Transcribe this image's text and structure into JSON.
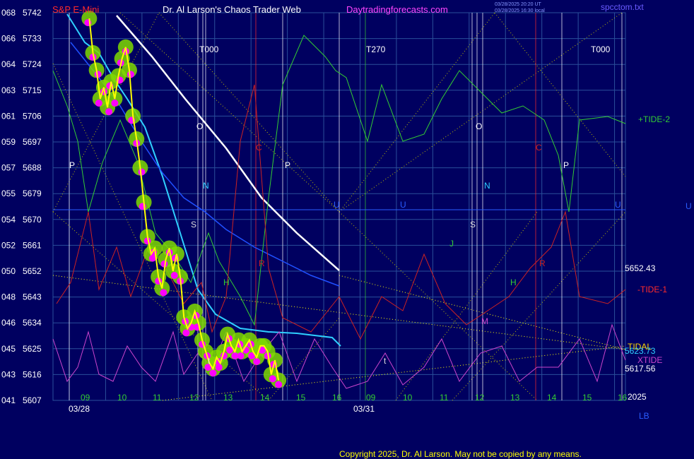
{
  "header": {
    "instrument": "S&P E-Mini",
    "title": "Dr. Al Larson's Chaos Trader Web",
    "site": "Daytradingforecasts.com",
    "stamp1": "03/28/2025 20:20 UT",
    "stamp2": "03/28/2025 16:30 local",
    "file": "spcctom.txt"
  },
  "footer": {
    "copyright": "Copyright 2025, Dr. Al Larson. May not be copied by any means."
  },
  "colors": {
    "background": "#000060",
    "grid": "#2a4f9a",
    "price_bar": "#ffff00",
    "cloud": "#7fd900",
    "dots": "#ff00ff",
    "ma_cyan": "#2fd0ff",
    "ma_blue": "#2050ff",
    "white_curve": "#ffffff",
    "tide2": "#33cc33",
    "tide1": "#cc2222",
    "xtide": "#cc44cc",
    "text_red": "#ff2a2a",
    "text_white": "#ffffff",
    "text_magenta": "#ff44ff"
  },
  "chart_data": {
    "type": "line",
    "title": "S&P E-Mini",
    "y_axis": {
      "labels_left": [
        "068",
        "066",
        "064",
        "063",
        "061",
        "059",
        "057",
        "055",
        "054",
        "052",
        "050",
        "048",
        "046",
        "045",
        "043",
        "041"
      ],
      "labels_price": [
        "5742",
        "5733",
        "5724",
        "5715",
        "5706",
        "5697",
        "5688",
        "5679",
        "5670",
        "5661",
        "5652",
        "5643",
        "5634",
        "5625",
        "5616",
        "5607"
      ],
      "range": [
        5607,
        5742
      ]
    },
    "x_axis": {
      "hour_labels_day1": [
        "09",
        "10",
        "11",
        "12",
        "13",
        "14",
        "15",
        "16"
      ],
      "hour_labels_day2": [
        "09",
        "10",
        "11",
        "12",
        "13",
        "14",
        "15",
        "16"
      ],
      "dates": [
        "03/28",
        "03/31"
      ],
      "year": "2025",
      "lb": "LB"
    },
    "right_labels": {
      "tide2": "+TIDE-2",
      "price_a": "5652.43",
      "tide1": "-TIDE-1",
      "tidal": "TIDAL",
      "price_b": "5623.73",
      "xtide": "XTIDE",
      "price_c": "5617.56",
      "u_right": "U"
    },
    "markers": {
      "t_labels": [
        "T000",
        "T270",
        "T000"
      ],
      "p_labels": [
        "P",
        "P",
        "P"
      ],
      "o_labels": [
        "O",
        "O"
      ],
      "n_labels": [
        "N",
        "N"
      ],
      "s_labels": [
        "S",
        "S"
      ],
      "c_labels": [
        "C",
        "C"
      ],
      "u_labels": [
        "U",
        "U",
        "U"
      ],
      "h_labels": [
        "H",
        "H"
      ],
      "r_labels": [
        "R",
        "R"
      ],
      "j_label": "J",
      "m_label": "M",
      "t_small": [
        "t",
        "t"
      ]
    },
    "price_series": [
      [
        9.55,
        5740
      ],
      [
        9.65,
        5728
      ],
      [
        9.75,
        5722
      ],
      [
        9.85,
        5712
      ],
      [
        9.95,
        5716
      ],
      [
        10.05,
        5709
      ],
      [
        10.15,
        5718
      ],
      [
        10.25,
        5712
      ],
      [
        10.35,
        5720
      ],
      [
        10.45,
        5726
      ],
      [
        10.55,
        5730
      ],
      [
        10.65,
        5722
      ],
      [
        10.75,
        5706
      ],
      [
        10.85,
        5698
      ],
      [
        10.95,
        5688
      ],
      [
        11.05,
        5676
      ],
      [
        11.15,
        5664
      ],
      [
        11.25,
        5658
      ],
      [
        11.35,
        5660
      ],
      [
        11.45,
        5650
      ],
      [
        11.55,
        5646
      ],
      [
        11.65,
        5656
      ],
      [
        11.75,
        5660
      ],
      [
        11.85,
        5652
      ],
      [
        11.95,
        5658
      ],
      [
        12.05,
        5650
      ],
      [
        12.15,
        5636
      ],
      [
        12.25,
        5632
      ],
      [
        12.35,
        5634
      ],
      [
        12.45,
        5638
      ],
      [
        12.55,
        5634
      ],
      [
        12.65,
        5628
      ],
      [
        12.75,
        5624
      ],
      [
        12.85,
        5620
      ],
      [
        12.95,
        5618
      ],
      [
        13.05,
        5622
      ],
      [
        13.15,
        5620
      ],
      [
        13.25,
        5624
      ],
      [
        13.35,
        5630
      ],
      [
        13.45,
        5626
      ],
      [
        13.55,
        5624
      ],
      [
        13.65,
        5628
      ],
      [
        13.75,
        5624
      ],
      [
        13.85,
        5626
      ],
      [
        13.95,
        5628
      ],
      [
        14.05,
        5624
      ],
      [
        14.15,
        5622
      ],
      [
        14.25,
        5626
      ],
      [
        14.35,
        5626
      ],
      [
        14.45,
        5624
      ],
      [
        14.55,
        5616
      ],
      [
        14.65,
        5621
      ],
      [
        14.75,
        5614
      ]
    ]
  }
}
